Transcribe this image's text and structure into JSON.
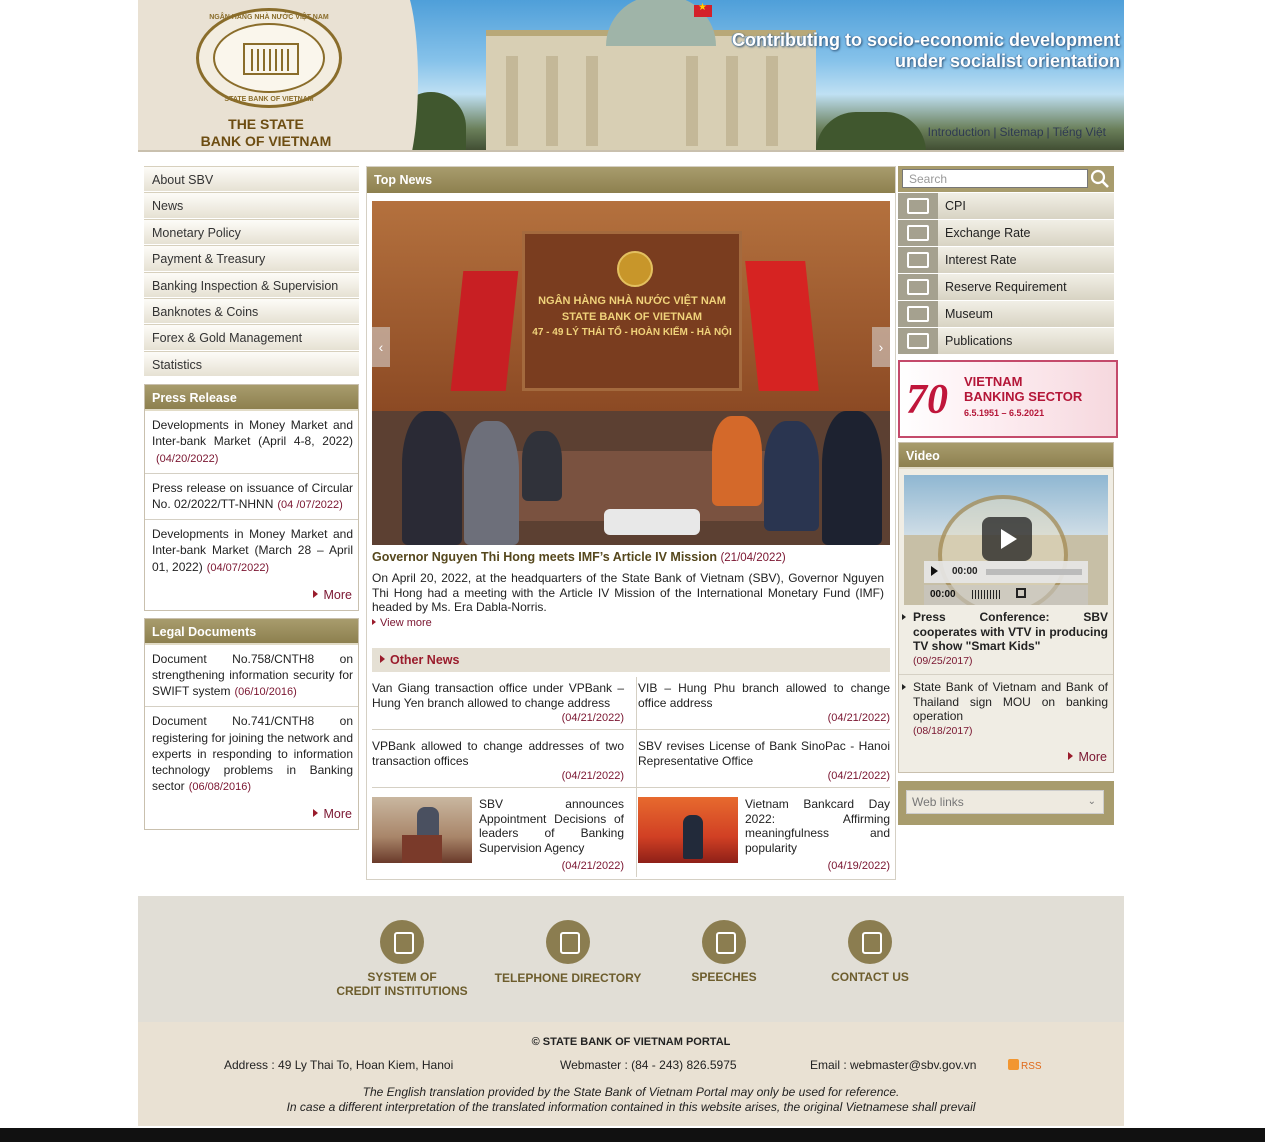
{
  "header": {
    "bank_name_line1": "THE STATE",
    "bank_name_line2": "BANK OF VIETNAM",
    "seal_top": "NGÂN HÀNG NHÀ NƯỚC VIỆT NAM",
    "seal_bottom": "STATE BANK OF VIETNAM",
    "slogan_line1": "Contributing to socio-economic development",
    "slogan_line2": "under socialist orientation",
    "links": [
      "Introduction",
      "Sitemap",
      "Tiếng Việt"
    ]
  },
  "nav": {
    "items": [
      "About SBV",
      "News",
      "Monetary Policy",
      "Payment & Treasury",
      "Banking Inspection & Supervision",
      "Banknotes & Coins",
      "Forex & Gold Management",
      "Statistics"
    ]
  },
  "press_release": {
    "title": "Press Release",
    "items": [
      {
        "text": "Developments in Money Market and Inter-bank Market (April 4-8, 2022)",
        "date": "(04/20/2022)"
      },
      {
        "text": "Press release on issuance of Circular No. 02/2022/TT-NHNN",
        "date": "(04 /07/2022)"
      },
      {
        "text": "Developments in Money Market and Inter-bank Market (March 28 – April 01, 2022)",
        "date": "(04/07/2022)"
      }
    ],
    "more": "More"
  },
  "legal_documents": {
    "title": "Legal Documents",
    "items": [
      {
        "text": "Document No.758/CNTH8 on strengthening information security for SWIFT system",
        "date": "(06/10/2016)"
      },
      {
        "text": "Document No.741/CNTH8 on registering for joining the network and experts in responding to information technology problems in Banking sector",
        "date": "(06/08/2016)"
      }
    ],
    "more": "More"
  },
  "top_news": {
    "title": "Top News",
    "slide_wall_line1": "NGÂN HÀNG NHÀ NƯỚC VIỆT NAM",
    "slide_wall_line2": "STATE BANK OF VIETNAM",
    "slide_wall_line3": "47 - 49 LÝ THÁI TỔ - HOÀN KIẾM - HÀ NỘI",
    "headline": "Governor Nguyen Thi Hong meets IMF’s Article IV Mission",
    "headline_date": "(21/04/2022)",
    "summary": "On April 20, 2022, at the headquarters of the State Bank of Vietnam (SBV), Governor Nguyen Thi Hong had a meeting with the Article IV Mission of the International Monetary Fund (IMF) headed by Ms. Era Dabla-Norris.",
    "view_more": "View more"
  },
  "other_news": {
    "title": "Other News",
    "items": [
      {
        "text": "Van Giang transaction office under VPBank – Hung Yen branch allowed to change address",
        "date": "(04/21/2022)"
      },
      {
        "text": "VIB – Hung Phu branch allowed to change office address",
        "date": "(04/21/2022)"
      },
      {
        "text": "VPBank allowed to change addresses of two transaction offices",
        "date": "(04/21/2022)"
      },
      {
        "text": "SBV revises License of Bank SinoPac - Hanoi Representative Office",
        "date": "(04/21/2022)"
      },
      {
        "text": "SBV announces Appointment Decisions of leaders of Banking Supervision Agency",
        "date": "(04/21/2022)"
      },
      {
        "text": "Vietnam Bankcard Day 2022: Affirming meaningfulness and popularity",
        "date": "(04/19/2022)"
      }
    ]
  },
  "right": {
    "search_placeholder": "Search",
    "quick_links": [
      "CPI",
      "Exchange Rate",
      "Interest Rate",
      "Reserve Requirement",
      "Museum",
      "Publications"
    ],
    "anniversary_number": "70",
    "anniversary_line1": "VIETNAM",
    "anniversary_line2": "BANKING SECTOR",
    "anniversary_dates": "6.5.1951 – 6.5.2021",
    "video_title": "Video",
    "video_time1": "00:00",
    "video_time2": "00:00",
    "video_items": [
      {
        "text": "Press Conference: SBV cooperates with VTV in producing TV show \"Smart Kids\"",
        "date": "(09/25/2017)"
      },
      {
        "text": "State Bank of Vietnam and Bank of Thailand sign MOU on banking operation",
        "date": "(08/18/2017)"
      }
    ],
    "video_more": "More",
    "weblinks_label": "Web links"
  },
  "footer_icons": [
    {
      "line1": "SYSTEM OF",
      "line2": "CREDIT INSTITUTIONS"
    },
    {
      "line1": "TELEPHONE DIRECTORY",
      "line2": ""
    },
    {
      "line1": "SPEECHES",
      "line2": ""
    },
    {
      "line1": "CONTACT US",
      "line2": ""
    }
  ],
  "footer": {
    "copyright": "© STATE BANK OF VIETNAM PORTAL",
    "address": "Address : 49 Ly Thai To, Hoan Kiem, Hanoi",
    "webmaster": "Webmaster : (84 - 243) 826.5975",
    "email": "Email : webmaster@sbv.gov.vn",
    "rss": "RSS",
    "note1": "The English translation provided by the State Bank of Vietnam Portal may only be used for reference.",
    "note2": "In case a different interpretation of the translated information contained in this website arises, the original Vietnamese shall prevail"
  }
}
